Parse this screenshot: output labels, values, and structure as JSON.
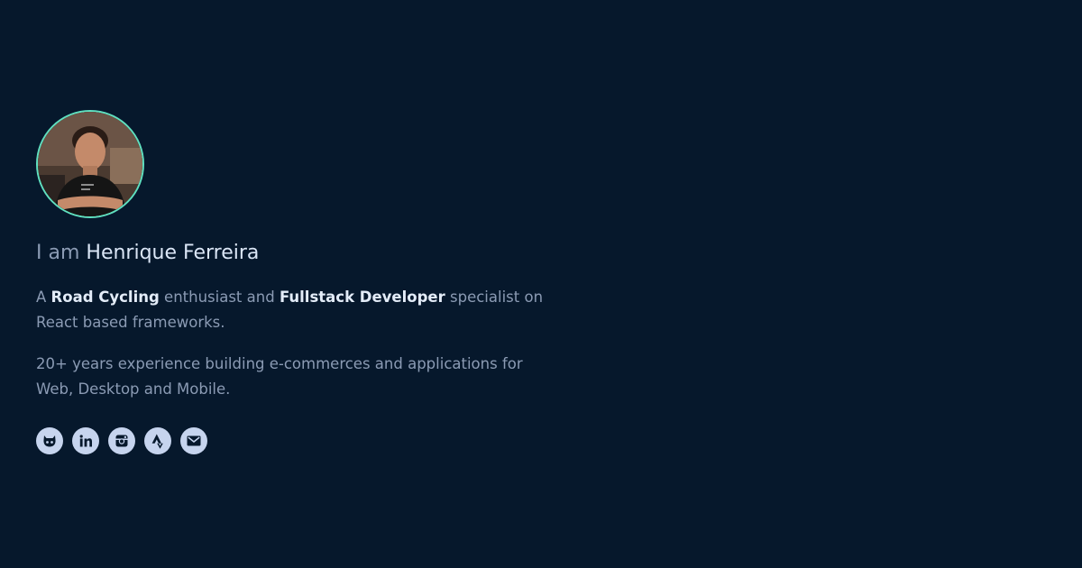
{
  "profile": {
    "intro_prefix": "I am",
    "name": "Henrique Ferreira",
    "bio1": {
      "t1": "A",
      "hobby": "Road Cycling",
      "t2": "enthusiast and",
      "role": "Fullstack Developer",
      "t3": "specialist on React based frameworks."
    },
    "bio2": "20+ years experience building e-commerces and applications for Web, Desktop and Mobile."
  },
  "socials": [
    {
      "icon": "github-icon"
    },
    {
      "icon": "linkedin-icon"
    },
    {
      "icon": "instagram-icon"
    },
    {
      "icon": "strava-icon"
    },
    {
      "icon": "email-icon"
    }
  ],
  "colors": {
    "background": "#06182c",
    "accent": "#5fe0c0",
    "text": "#8b9bb4",
    "text_strong": "#e3ecf8",
    "icon_bg": "#c6d4ee"
  }
}
